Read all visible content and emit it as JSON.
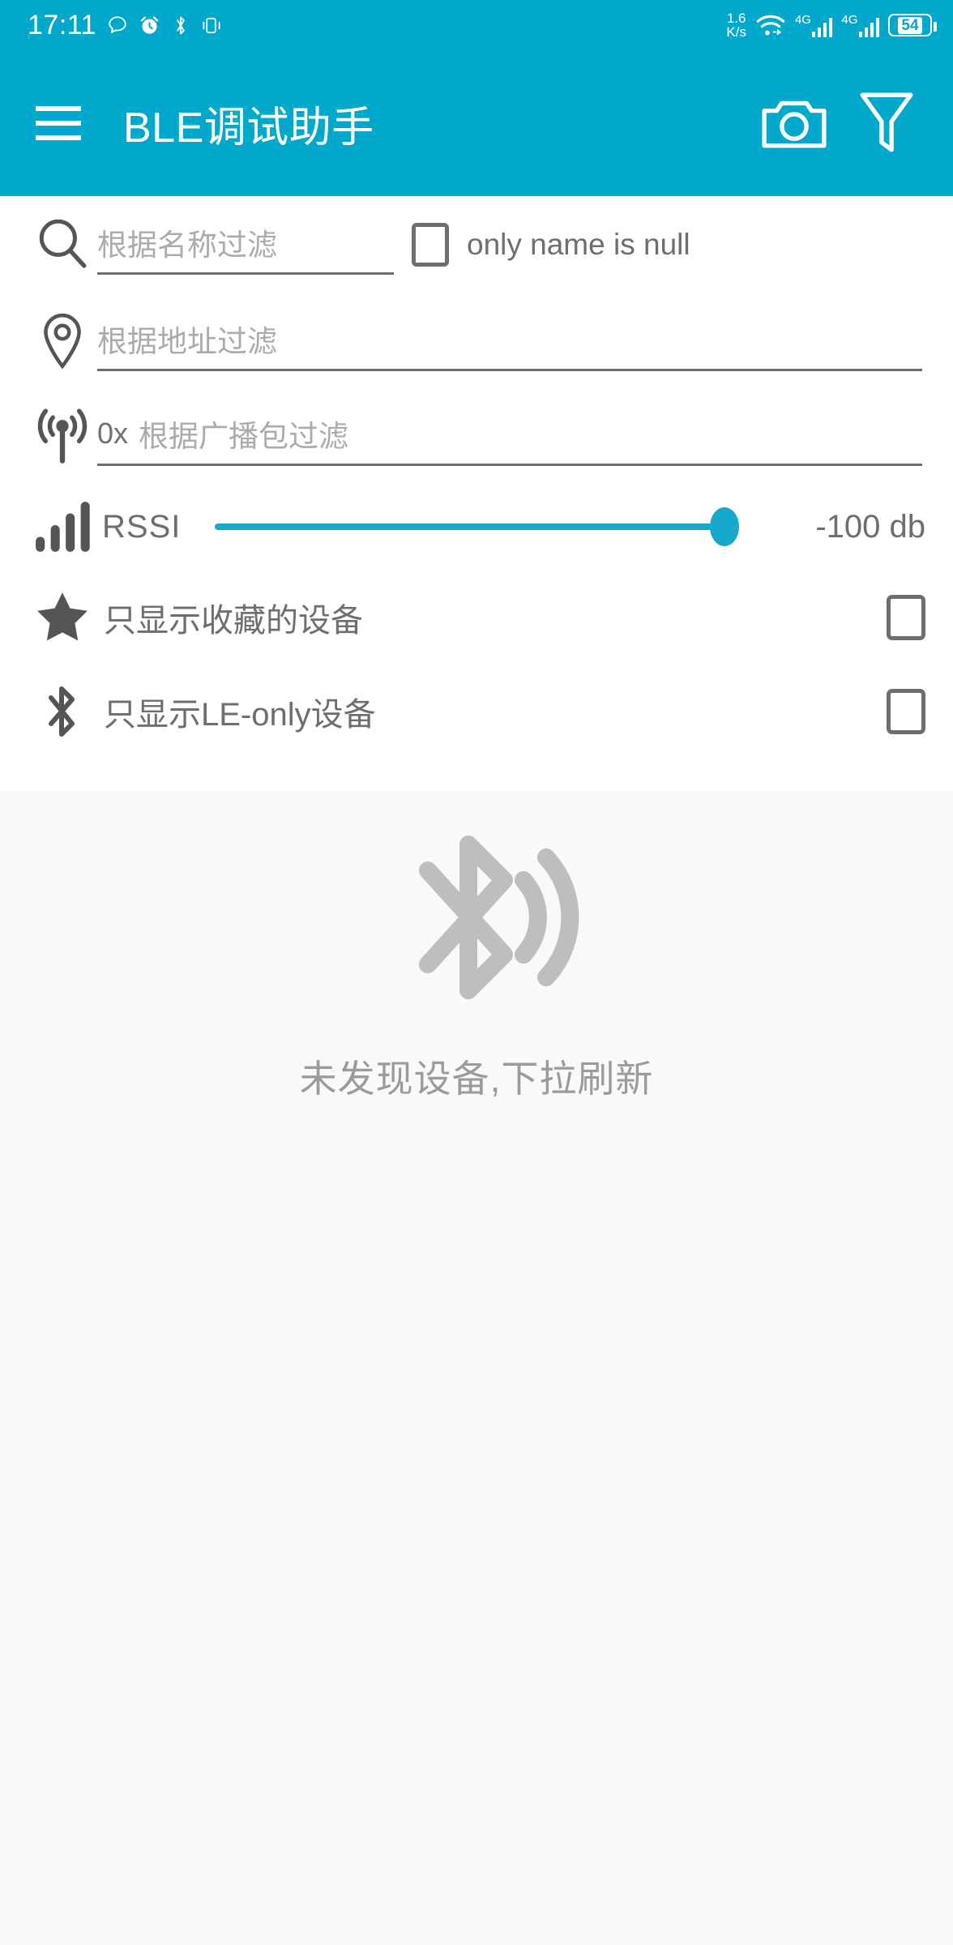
{
  "status_bar": {
    "time": "17:11",
    "icons": [
      "message-icon",
      "alarm-icon",
      "bluetooth-icon",
      "vibrate-icon"
    ],
    "net_rate_value": "1.6",
    "net_rate_unit": "K/s",
    "wifi": "wifi-icon",
    "sim1_label": "4G",
    "sim2_label": "4G",
    "battery_percent": "54",
    "accent": "#00A8CC"
  },
  "app_bar": {
    "menu_icon": "hamburger-icon",
    "title": "BLE调试助手",
    "camera_icon": "camera-icon",
    "filter_icon": "funnel-icon"
  },
  "filters": {
    "name": {
      "icon": "search-icon",
      "placeholder": "根据名称过滤",
      "value": ""
    },
    "name_null_checkbox": {
      "label": "only name is null",
      "checked": false
    },
    "address": {
      "icon": "location-pin-icon",
      "placeholder": "根据地址过滤",
      "value": ""
    },
    "advertising": {
      "icon": "broadcast-icon",
      "prefix": "0x",
      "placeholder": "根据广播包过滤",
      "value": ""
    },
    "rssi": {
      "icon": "signal-bars-icon",
      "label": "RSSI",
      "value_text": "-100 db",
      "value": -100,
      "min": -100,
      "max": 0,
      "thumb_percent": 100,
      "track_color": "#18A8CB"
    },
    "favorites_only": {
      "icon": "star-icon",
      "label": "只显示收藏的设备",
      "checked": false
    },
    "le_only": {
      "icon": "bluetooth-icon",
      "label": "只显示LE-only设备",
      "checked": false
    }
  },
  "empty_state": {
    "icon": "bluetooth-searching-icon",
    "message": "未发现设备,下拉刷新"
  }
}
